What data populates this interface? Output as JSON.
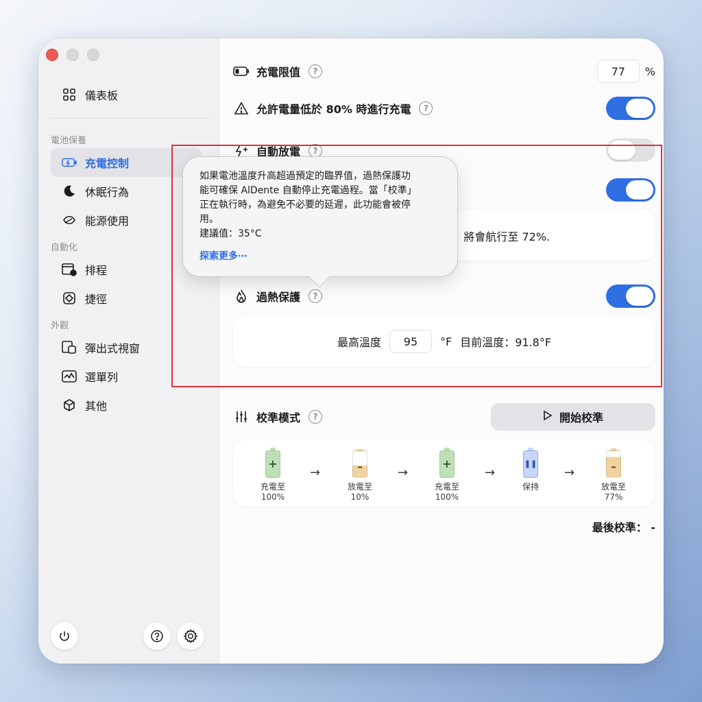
{
  "sidebar": {
    "dashboard": "儀表板",
    "section_battery": "電池保養",
    "charge_control": "充電控制",
    "sleep": "休眠行為",
    "energy": "能源使用",
    "section_automation": "自動化",
    "schedule": "排程",
    "shortcuts": "捷徑",
    "section_appearance": "外觀",
    "popover": "彈出式視窗",
    "menubar": "選單列",
    "other": "其他"
  },
  "main": {
    "charge_limit_label": "充電限值",
    "charge_limit_value": "77",
    "percent": "%",
    "allow_below_label": "允許電量低於 80% 時進行充電",
    "auto_discharge_label": "自動放電",
    "sailing_text": "將會航行至 72%.",
    "heat_protection_label": "過熱保護",
    "max_temp_label": "最高溫度",
    "max_temp_value": "95",
    "temp_unit": "°F",
    "current_temp": "目前溫度：91.8°F",
    "calibration_label": "校準模式",
    "start_calibration": "開始校準",
    "last_calibration": "最後校準：  -"
  },
  "steps": [
    {
      "line1": "充電至",
      "line2": "100%",
      "icon": "battery-charge-icon",
      "color": "#bfe0b6"
    },
    {
      "line1": "放電至",
      "line2": "10%",
      "icon": "battery-discharge-icon",
      "color": "#f4e2bd"
    },
    {
      "line1": "充電至",
      "line2": "100%",
      "icon": "battery-charge-icon",
      "color": "#bfe0b6"
    },
    {
      "line1": "保持",
      "line2": "",
      "icon": "battery-hold-icon",
      "color": "#c7d6f7"
    },
    {
      "line1": "放電至",
      "line2": "77%",
      "icon": "battery-discharge-icon",
      "color": "#f4e2bd"
    }
  ],
  "tooltip": {
    "line1": "如果電池溫度升高超過預定的臨界值，過熱保護功",
    "line2": "能可確保 AlDente 自動停止充電過程。當「校準」",
    "line3": "正在執行時，為避免不必要的延遲，此功能會被停",
    "line4": "用。",
    "recommended": "建議值：35°C",
    "more": "探索更多⋯"
  },
  "colors": {
    "accent": "#2f6fe4",
    "highlight": "#e0303a"
  }
}
